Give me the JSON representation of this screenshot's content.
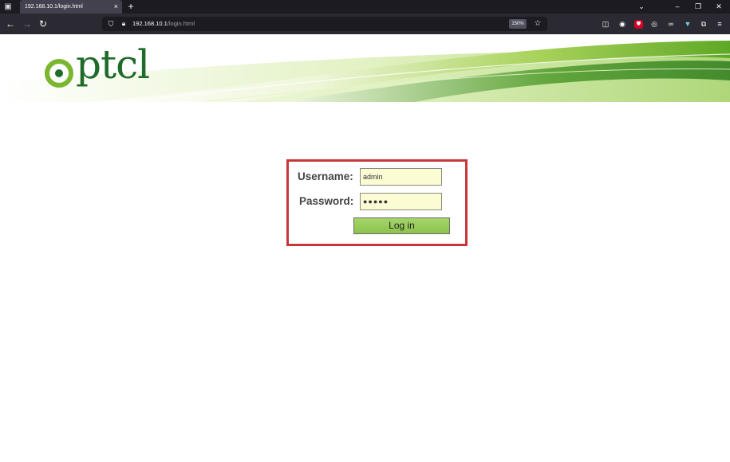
{
  "browser": {
    "tab_title": "192.168.10.1/login.html",
    "tab_close": "×",
    "new_tab": "+",
    "url_host": "192.168.10.1",
    "url_path": "/login.html",
    "zoom": "150%"
  },
  "brand": {
    "logo_text": "ptcl",
    "colors": {
      "green": "#6fb12e",
      "dark_green": "#1e6b2a",
      "border_red": "#c7363a",
      "button_green": "#95c957"
    }
  },
  "login": {
    "username_label": "Username:",
    "username_value": "admin",
    "password_label": "Password:",
    "password_mask": "●●●●●",
    "login_button": "Log in"
  },
  "icons": [
    "tab-list-icon",
    "back-arrow-icon",
    "forward-arrow-icon",
    "reload-icon",
    "shield-icon",
    "lock-icon",
    "star-icon",
    "pocket-icon",
    "account-icon",
    "ublock-icon",
    "extension-icon",
    "mask-icon",
    "extensions-puzzle-icon",
    "menu-icon"
  ]
}
